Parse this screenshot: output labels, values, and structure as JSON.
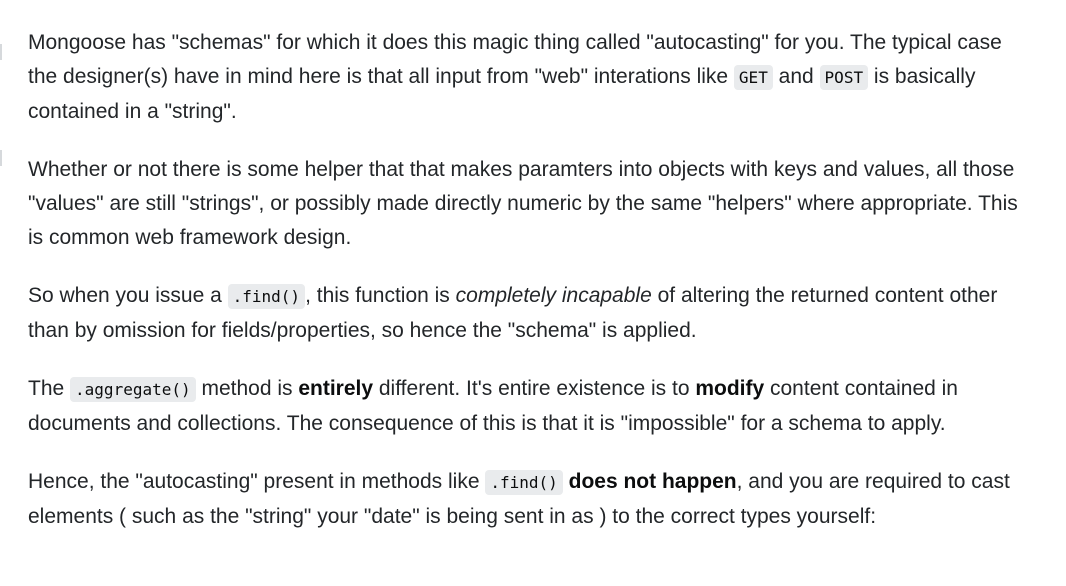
{
  "paragraphs": [
    {
      "p1_t1": "Mongoose has \"schemas\" for which it does this magic thing called \"autocasting\" for you. The typical case the designer(s) have in mind here is that all input from \"web\" interations like ",
      "p1_code1": "GET",
      "p1_t2": " and ",
      "p1_code2": "POST",
      "p1_t3": " is basically contained in a \"string\"."
    },
    {
      "p2_t1": "Whether or not there is some helper that that makes paramters into objects with keys and values, all those \"values\" are still \"strings\", or possibly made directly numeric by the same \"helpers\" where appropriate. This is common web framework design."
    },
    {
      "p3_t1": "So when you issue a ",
      "p3_code1": ".find()",
      "p3_t2": ", this function is ",
      "p3_em1": "completely incapable",
      "p3_t3": " of altering the returned content other than by omission for fields/properties, so hence the \"schema\" is applied."
    },
    {
      "p4_t1": "The ",
      "p4_code1": ".aggregate()",
      "p4_t2": " method is ",
      "p4_strong1": "entirely",
      "p4_t3": " different. It's entire existence is to ",
      "p4_strong2": "modify",
      "p4_t4": " content contained in documents and collections. The consequence of this is that it is \"impossible\" for a schema to apply."
    },
    {
      "p5_t1": "Hence, the \"autocasting\" present in methods like ",
      "p5_code1": ".find()",
      "p5_t2": " ",
      "p5_strong1": "does not happen",
      "p5_t3": ", and you are required to cast elements ( such as the \"string\" your \"date\" is being sent in as ) to the correct types yourself:"
    }
  ]
}
